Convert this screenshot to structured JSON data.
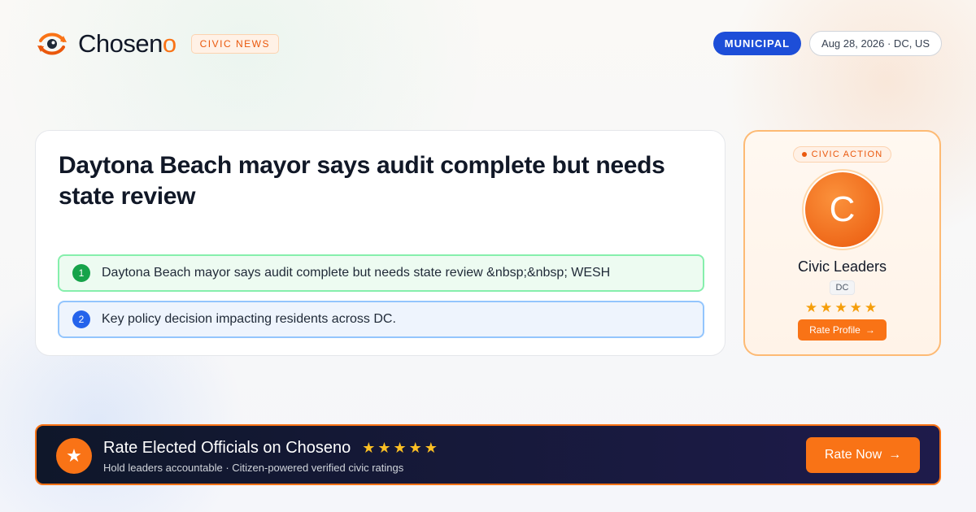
{
  "brand": {
    "name_main": "Chosen",
    "name_accent": "o",
    "tag": "CIVIC NEWS",
    "icon": "eye-logo-icon"
  },
  "header": {
    "category": "MUNICIPAL",
    "date_location": "Aug 28, 2026 · DC, US"
  },
  "article": {
    "headline": "Daytona Beach mayor says audit complete but needs state review",
    "points": [
      {
        "num": "1",
        "text": "Daytona Beach mayor says audit complete but needs state review &nbsp;&nbsp; WESH"
      },
      {
        "num": "2",
        "text": "Key policy decision impacting residents across DC."
      }
    ]
  },
  "civic_card": {
    "tag": "CIVIC ACTION",
    "avatar_letter": "C",
    "name": "Civic Leaders",
    "region": "DC",
    "stars": "★★★★★",
    "button_label": "Rate Profile",
    "button_arrow": "→"
  },
  "banner": {
    "icon": "star-icon",
    "title": "Rate Elected Officials on Choseno",
    "stars": "★★★★★",
    "subtitle": "Hold leaders accountable · Citizen-powered verified civic ratings",
    "button_label": "Rate Now",
    "button_arrow": "→"
  },
  "colors": {
    "accent": "#f97316",
    "municipal": "#1d4ed8",
    "green": "#16a34a",
    "blue": "#2563eb"
  }
}
